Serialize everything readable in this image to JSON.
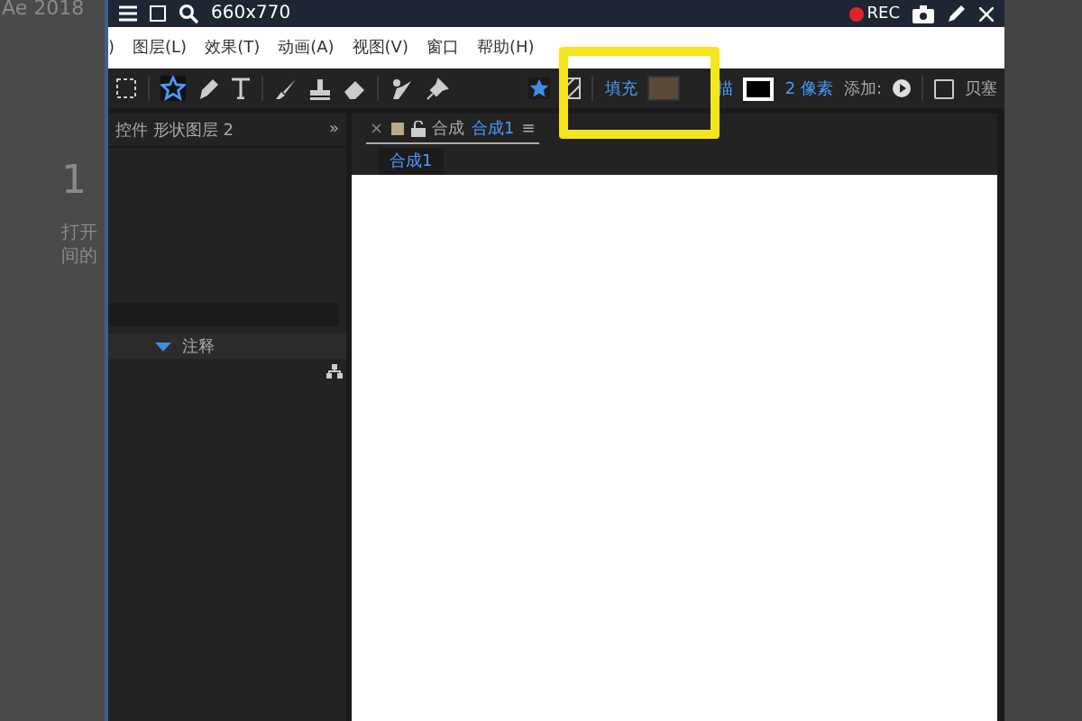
{
  "page": {
    "title": "Ae 2018",
    "step": "1",
    "text_lines": [
      "打开",
      "间的"
    ]
  },
  "window": {
    "title": "660x770",
    "rec": "REC"
  },
  "menu": [
    ")",
    "图层(L)",
    "效果(T)",
    "动画(A)",
    "视图(V)",
    "窗口",
    "帮助(H)"
  ],
  "toolbar": {
    "fill_label": "填充",
    "stroke_label": "描",
    "stroke_width": "2 像素",
    "add_label": "添加:",
    "bezier": {
      "label": "贝塞",
      "checked": false
    }
  },
  "left_panel": {
    "title": "控件 形状图层 2",
    "expand": "»",
    "row_label": "注释"
  },
  "comp_panel": {
    "close": "×",
    "tab_prefix": "合成",
    "tab_name": "合成1",
    "menu": "≡",
    "subtab": "合成1"
  }
}
